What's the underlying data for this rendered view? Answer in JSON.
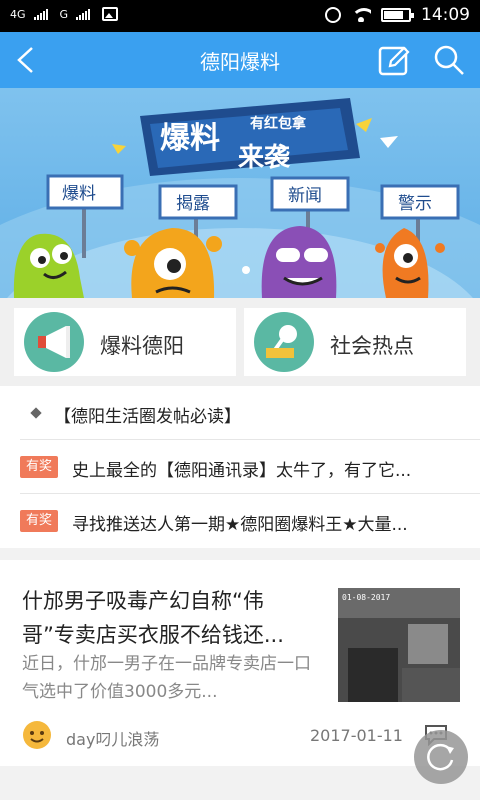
{
  "status_bar": {
    "net1": "4G",
    "net2": "G",
    "time": "14:09"
  },
  "header": {
    "title": "德阳爆料"
  },
  "banner": {
    "headline_line1": "爆料",
    "headline_small": "有红包拿",
    "headline_line2": "来袭",
    "signs": [
      "爆料",
      "揭露",
      "新闻",
      "警示"
    ]
  },
  "quick_links": [
    {
      "label": "爆料德阳",
      "icon": "megaphone-icon"
    },
    {
      "label": "社会热点",
      "icon": "news-microphone-icon"
    }
  ],
  "notices": [
    {
      "text": "【德阳生活圈发帖必读】"
    },
    {
      "badge": "有奖",
      "text": "史上最全的【德阳通讯录】太牛了，有了它..."
    },
    {
      "badge": "有奖",
      "text": "寻找推送达人第一期★德阳圈爆料王★大量..."
    }
  ],
  "article": {
    "title": "什邡男子吸毒产幻自称“伟哥”专卖店买衣服不给钱还...",
    "summary": "近日，什邡一男子在一品牌专卖店一口气选中了价值3000多元...",
    "thumb_timestamp": "01-08-2017",
    "author": "day叼儿浪荡",
    "date": "2017-01-11"
  },
  "colors": {
    "header": "#3aa0f0",
    "badge": "#f07a5a",
    "card_circle": "#5ab8a3"
  }
}
